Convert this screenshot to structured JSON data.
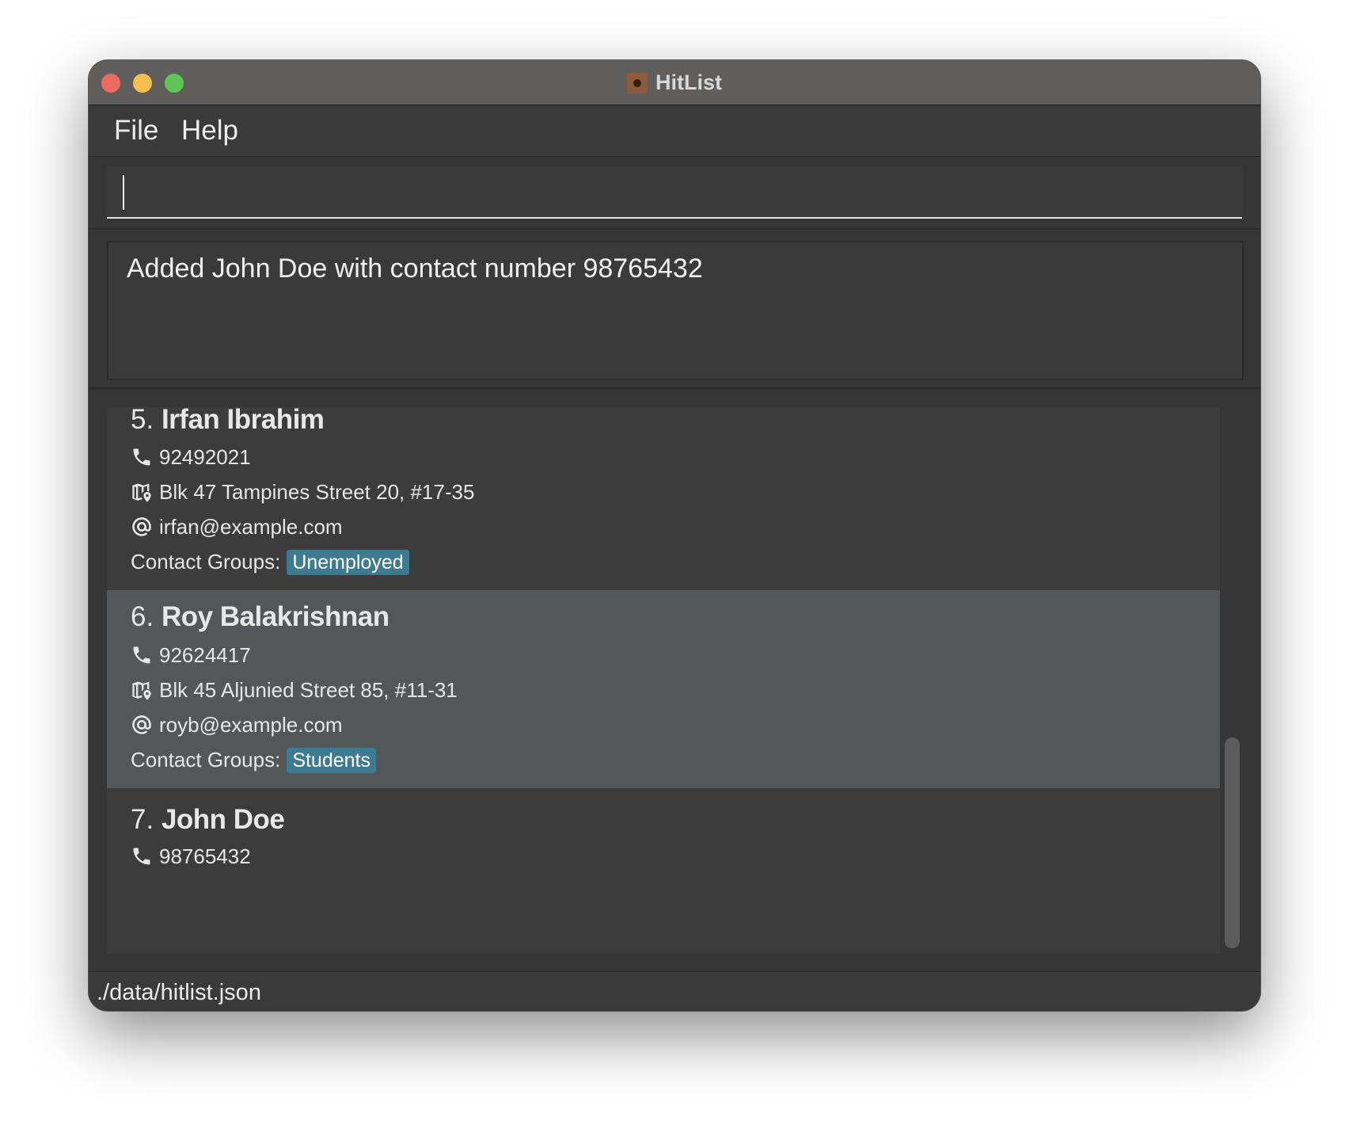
{
  "window": {
    "title": "HitList",
    "app_icon": "hitlist-app-icon"
  },
  "menu": {
    "file": "File",
    "help": "Help"
  },
  "command": {
    "value": ""
  },
  "result": {
    "message": "Added John Doe with contact number 98765432"
  },
  "contacts": [
    {
      "index": "5.",
      "name": "Irfan Ibrahim",
      "phone": "92492021",
      "address": "Blk 47 Tampines Street 20, #17-35",
      "email": "irfan@example.com",
      "groups_label": "Contact Groups:",
      "groups": [
        "Unemployed"
      ],
      "selected": false
    },
    {
      "index": "6.",
      "name": "Roy Balakrishnan",
      "phone": "92624417",
      "address": "Blk 45 Aljunied Street 85, #11-31",
      "email": "royb@example.com",
      "groups_label": "Contact Groups:",
      "groups": [
        "Students"
      ],
      "selected": true
    },
    {
      "index": "7.",
      "name": "John Doe",
      "phone": "98765432",
      "selected": false
    }
  ],
  "status": {
    "path": "./data/hitlist.json"
  },
  "colors": {
    "tag_bg": "#3e7b91",
    "selected_card_bg": "#535759",
    "window_bg": "#363636"
  }
}
